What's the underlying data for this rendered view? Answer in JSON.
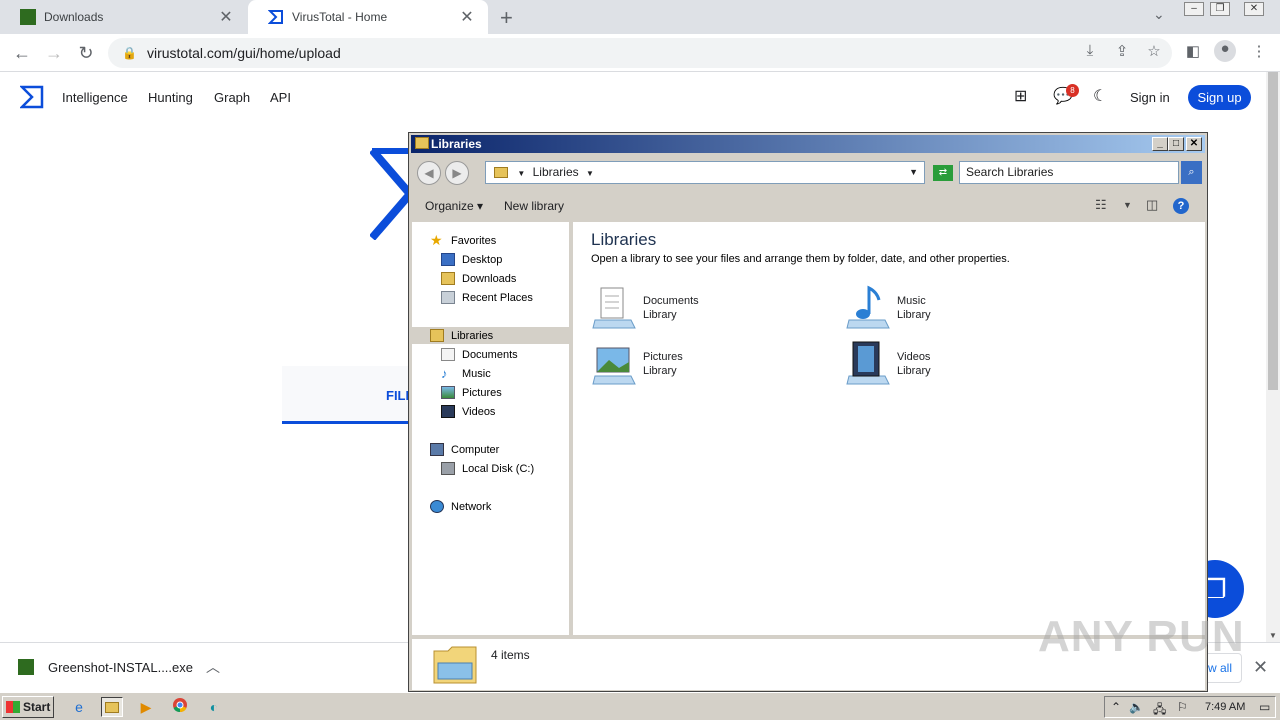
{
  "browser": {
    "tabs": [
      {
        "title": "Downloads",
        "close": "✕"
      },
      {
        "title": "VirusTotal - Home",
        "close": "✕"
      }
    ],
    "new_tab": "+",
    "url": "virustotal.com/gui/home/upload"
  },
  "vt": {
    "nav": [
      "Intelligence",
      "Hunting",
      "Graph",
      "API"
    ],
    "notification_count": "8",
    "sign_in": "Sign in",
    "sign_up": "Sign up",
    "file_tab": "FILE"
  },
  "explorer": {
    "title": "Libraries",
    "path": "Libraries",
    "search_placeholder": "Search Libraries",
    "commands": {
      "organize": "Organize",
      "new_library": "New library"
    },
    "nav": {
      "favorites": "Favorites",
      "desktop": "Desktop",
      "downloads": "Downloads",
      "recent": "Recent Places",
      "libraries": "Libraries",
      "documents": "Documents",
      "music": "Music",
      "pictures": "Pictures",
      "videos": "Videos",
      "computer": "Computer",
      "local_disk": "Local Disk (C:)",
      "network": "Network"
    },
    "heading": "Libraries",
    "description": "Open a library to see your files and arrange them by folder, date, and other properties.",
    "libraries": [
      {
        "name": "Documents",
        "type": "Library"
      },
      {
        "name": "Music",
        "type": "Library"
      },
      {
        "name": "Pictures",
        "type": "Library"
      },
      {
        "name": "Videos",
        "type": "Library"
      }
    ],
    "status": "4 items"
  },
  "download_bar": {
    "file": "Greenshot-INSTAL....exe",
    "show_all": "w all"
  },
  "watermark": "ANY RUN",
  "taskbar": {
    "start": "Start",
    "clock": "7:49 AM"
  },
  "colors": {
    "vt_blue": "#0b4dda",
    "title_bar": "#0a246a"
  }
}
